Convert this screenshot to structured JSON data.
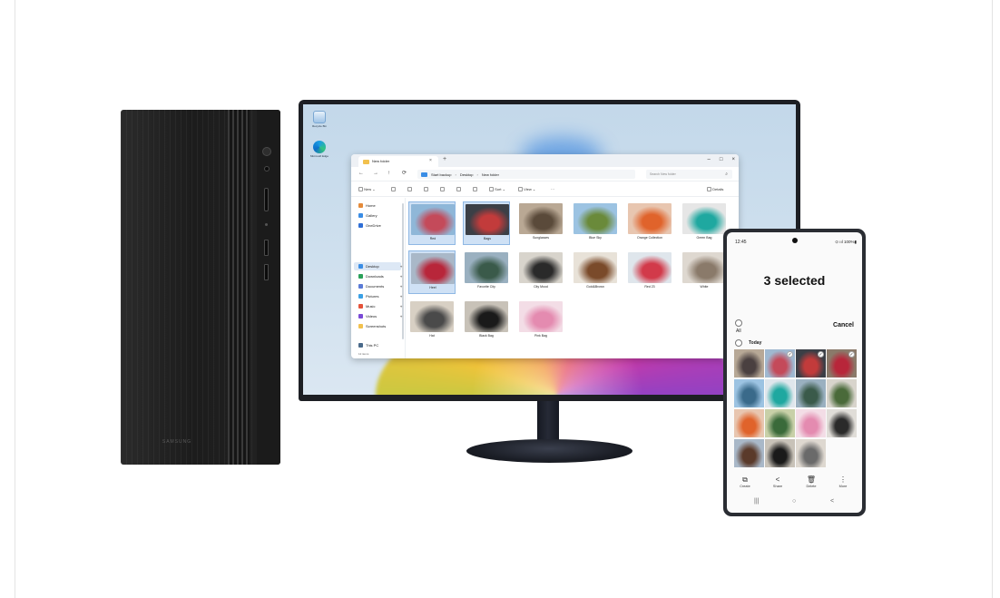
{
  "tower": {
    "brand": "SAMSUNG"
  },
  "desktop": {
    "icons": [
      {
        "label": "Recycle Bin"
      },
      {
        "label": "Microsoft Edge"
      }
    ]
  },
  "explorer": {
    "tab_title": "New folder",
    "tab_close": "×",
    "new_tab": "+",
    "window_controls": [
      "–",
      "□",
      "×"
    ],
    "nav_buttons": [
      "←",
      "→",
      "↑",
      "⟳"
    ],
    "path": [
      "Start backup",
      "Desktop",
      "New folder"
    ],
    "path_sep": "›",
    "search_placeholder": "Search New folder",
    "toolbar": {
      "new": "New ⌄",
      "sort": "Sort ⌄",
      "view": "View ⌄",
      "more": "···",
      "details": "Details"
    },
    "sidebar": [
      {
        "label": "Home",
        "color": "#e58b3a"
      },
      {
        "label": "Gallery",
        "color": "#3a8de5"
      },
      {
        "label": "OneDrive",
        "color": "#2f6fd6"
      },
      {
        "label": "Desktop",
        "color": "#3a8de5"
      },
      {
        "label": "Downloads",
        "color": "#2aa15a"
      },
      {
        "label": "Documents",
        "color": "#5a7bd6"
      },
      {
        "label": "Pictures",
        "color": "#3aa0e5"
      },
      {
        "label": "Music",
        "color": "#e5533a"
      },
      {
        "label": "Videos",
        "color": "#7a4ad6"
      },
      {
        "label": "Screenshots",
        "color": "#f2c14e"
      },
      {
        "label": "This PC",
        "color": "#4a6a8a"
      }
    ],
    "sidebar_footer": "12 items",
    "files": [
      {
        "name": "Red",
        "selected": true,
        "colors": [
          "#8fb7d8",
          "#c44a5a"
        ]
      },
      {
        "name": "Bags",
        "selected": true,
        "colors": [
          "#3b3f46",
          "#c23b3b"
        ]
      },
      {
        "name": "Sunglasses",
        "selected": false,
        "colors": [
          "#b9a894",
          "#5a4a3a"
        ]
      },
      {
        "name": "Blue Sky",
        "selected": false,
        "colors": [
          "#9cc3e2",
          "#6a8a3a"
        ]
      },
      {
        "name": "Orange Collection",
        "selected": false,
        "colors": [
          "#e8c6b0",
          "#e0632b"
        ]
      },
      {
        "name": "Green Bag",
        "selected": false,
        "colors": [
          "#e6e6e6",
          "#1fa8a0"
        ]
      },
      {
        "name": "Heel",
        "selected": true,
        "colors": [
          "#a9b8c8",
          "#b8263a"
        ]
      },
      {
        "name": "Favorite City",
        "selected": false,
        "colors": [
          "#9ab0c0",
          "#3a5a4a"
        ]
      },
      {
        "name": "City Mood",
        "selected": false,
        "colors": [
          "#d8d4cc",
          "#2a2a2a"
        ]
      },
      {
        "name": "Gold&Brown",
        "selected": false,
        "colors": [
          "#e8e2d8",
          "#7a4a2a"
        ]
      },
      {
        "name": "Red 23",
        "selected": false,
        "colors": [
          "#dfe6ec",
          "#d23a4a"
        ]
      },
      {
        "name": "White",
        "selected": false,
        "colors": [
          "#ded8d0",
          "#8a7a6a"
        ]
      },
      {
        "name": "Hat",
        "selected": false,
        "colors": [
          "#d8d0c4",
          "#4a4a4a"
        ]
      },
      {
        "name": "Black Bag",
        "selected": false,
        "colors": [
          "#c8c2b8",
          "#1a1a1a"
        ]
      },
      {
        "name": "Pink Bag",
        "selected": false,
        "colors": [
          "#f3dde6",
          "#e48bb0"
        ]
      }
    ]
  },
  "phone": {
    "time": "12:45",
    "status_right": "⊙ ııl 100%▮",
    "title": "3 selected",
    "all_label": "All",
    "cancel": "Cancel",
    "today": "Today",
    "photos": [
      {
        "colors": [
          "#b7a896",
          "#4a4040"
        ],
        "checked": false
      },
      {
        "colors": [
          "#9fb8d0",
          "#c44a5a"
        ],
        "checked": true
      },
      {
        "colors": [
          "#3b3f46",
          "#c23b3b"
        ],
        "checked": true
      },
      {
        "colors": [
          "#8a7a6a",
          "#b8263a"
        ],
        "checked": true
      },
      {
        "colors": [
          "#9cc3e2",
          "#3a6a8a"
        ],
        "checked": false
      },
      {
        "colors": [
          "#dfe6ec",
          "#1fa8a0"
        ],
        "checked": false
      },
      {
        "colors": [
          "#9ab0c0",
          "#3a5a4a"
        ],
        "checked": false
      },
      {
        "colors": [
          "#d8d4cc",
          "#4a6a3a"
        ],
        "checked": false
      },
      {
        "colors": [
          "#e8c6b0",
          "#e0632b"
        ],
        "checked": false
      },
      {
        "colors": [
          "#c8d0a8",
          "#3a6a3a"
        ],
        "checked": false
      },
      {
        "colors": [
          "#f3dde6",
          "#e48bb0"
        ],
        "checked": false
      },
      {
        "colors": [
          "#e0ddd8",
          "#2a2a2a"
        ],
        "checked": false
      },
      {
        "colors": [
          "#a9b8c8",
          "#5a3a2a"
        ],
        "checked": false
      },
      {
        "colors": [
          "#c8c2b8",
          "#1a1a1a"
        ],
        "checked": false
      },
      {
        "colors": [
          "#ded8d0",
          "#6a6a6a"
        ],
        "checked": false
      }
    ],
    "actions": [
      {
        "icon": "⧉",
        "label": "Create"
      },
      {
        "icon": "<",
        "label": "Share"
      },
      {
        "icon": "🗑",
        "label": "Delete"
      },
      {
        "icon": "⋮",
        "label": "More"
      }
    ],
    "navbar": [
      "|||",
      "○",
      "<"
    ],
    "check_mark": "✓"
  }
}
